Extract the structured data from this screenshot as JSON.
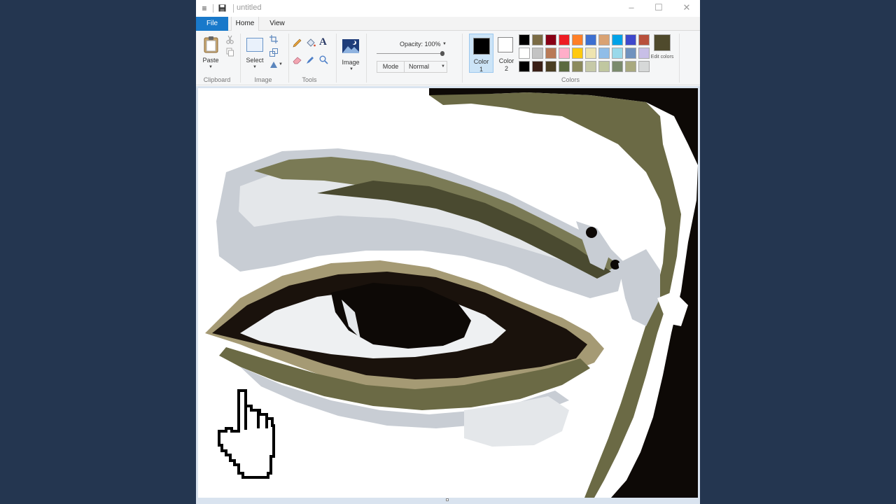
{
  "titlebar": {
    "title": "untitled",
    "menu_icon": "hamburger-icon",
    "save_icon": "floppy-disk-icon",
    "controls": {
      "minimize": "–",
      "maximize": "☐",
      "close": "✕"
    }
  },
  "tabs": [
    {
      "label": "File",
      "active": false,
      "highlight": true
    },
    {
      "label": "Home",
      "active": true
    },
    {
      "label": "View",
      "active": false
    }
  ],
  "ribbon": {
    "clipboard": {
      "group_label": "Clipboard",
      "paste_label": "Paste",
      "cut_icon": "scissors-icon",
      "copy_icon": "copy-icon"
    },
    "image": {
      "group_label": "Image",
      "select_label": "Select",
      "crop_icon": "crop-icon",
      "resize_icon": "resize-icon",
      "rotate_icon": "rotate-icon"
    },
    "tools": {
      "group_label": "Tools",
      "items": [
        "pencil-icon",
        "fill-bucket-icon",
        "text-icon",
        "eraser-icon",
        "color-picker-icon",
        "magnifier-icon"
      ],
      "text_glyph": "A"
    },
    "image_menu": {
      "label": "Image",
      "icon": "landscape-icon"
    },
    "opacity": {
      "label": "Opacity: 100%",
      "value": 1.0
    },
    "mode": {
      "label": "Mode",
      "value": "Normal"
    },
    "colors": {
      "group_label": "Colors",
      "color1": {
        "label_line1": "Color",
        "label_line2": "1",
        "value": "#000000"
      },
      "color2": {
        "label_line1": "Color",
        "label_line2": "2",
        "value": "#ffffff"
      },
      "palette_rows": [
        [
          "#000000",
          "#7a6b45",
          "#880015",
          "#ed1c24",
          "#ff7f27",
          "#3c6fd1",
          "#d9a273",
          "#00a2e8",
          "#3f48cc",
          "#b8503c"
        ],
        [
          "#ffffff",
          "#c3c3c3",
          "#b97a57",
          "#ffaec9",
          "#ffc90e",
          "#efe4b0",
          "#8fbde8",
          "#99d9ea",
          "#7092be",
          "#c8bfe7"
        ],
        [
          "#000000",
          "#3a1f16",
          "#4a3d22",
          "#5b6a40",
          "#8b8a5c",
          "#c6c9a8",
          "#c0c7a0",
          "#7b8b6c",
          "#a9a97f",
          "#d6d8d8"
        ]
      ],
      "edit_colors_label": "Edit colors",
      "edit_colors_swatch": "#4f4a2c"
    }
  },
  "canvas": {
    "content": "posterized eye artwork with large pixel hand cursor",
    "colors": {
      "dark": "#0d0906",
      "olive": "#6b6a45",
      "tan": "#a59a74",
      "grey": "#c8cdd4",
      "pale": "#e4e7ea",
      "white": "#ffffff"
    },
    "cursor_icon": "hand-pointer-icon"
  }
}
